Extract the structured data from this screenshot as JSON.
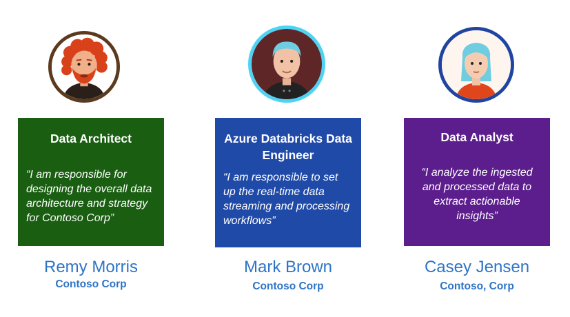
{
  "personas": [
    {
      "role": "Data Architect",
      "quote": "“I am responsible for designing the overall data architecture and strategy for Contoso Corp”",
      "name": "Remy Morris",
      "company": "Contoso Corp",
      "color": "#1a5e12",
      "ring_color": "#5b3a1e",
      "icon": "bearded-man-avatar-icon"
    },
    {
      "role": "Azure Databricks Data Engineer",
      "quote": "“I am responsible to set up the real-time data streaming and processing workflows”",
      "name": "Mark Brown",
      "company": "Contoso Corp",
      "color": "#1f4aa8",
      "ring_color": "#4fd3f5",
      "icon": "man-avatar-icon"
    },
    {
      "role": "Data Analyst",
      "quote": "“I analyze the ingested and processed data to extract actionable insights”",
      "name": "Casey Jensen",
      "company": "Contoso, Corp",
      "color": "#5c1e8c",
      "ring_color": "#1f45a0",
      "icon": "woman-avatar-icon"
    }
  ]
}
